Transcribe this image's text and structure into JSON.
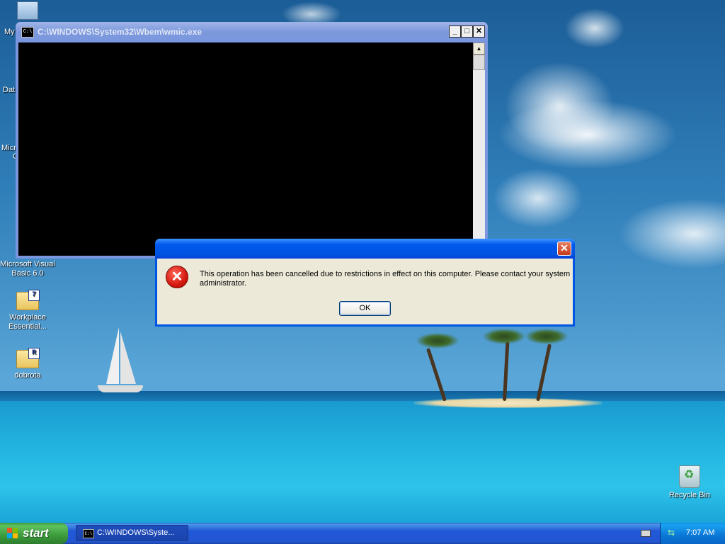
{
  "desktop": {
    "icons": [
      {
        "label": "My",
        "badge": ""
      },
      {
        "label": "Dat",
        "badge": ""
      },
      {
        "label": "Micro",
        "badge": ""
      },
      {
        "label": "C",
        "badge": ""
      },
      {
        "label": "Microsoft Visual Basic 6.0",
        "badge": ""
      },
      {
        "label": "Workplace Essential...",
        "badge": "7"
      },
      {
        "label": "dobrota",
        "badge": "R"
      },
      {
        "label": "Recycle Bin",
        "badge": ""
      }
    ]
  },
  "console_window": {
    "title": "C:\\WINDOWS\\System32\\Wbem\\wmic.exe",
    "icon_text": "C:\\",
    "buttons": {
      "minimize": "_",
      "maximize": "□",
      "close": "✕"
    }
  },
  "error_dialog": {
    "title": "",
    "message": "This operation has been cancelled due to restrictions in effect on this computer. Please contact your system administrator.",
    "icon_glyph": "✕",
    "ok_label": "OK",
    "close_glyph": "✕"
  },
  "taskbar": {
    "start_label": "start",
    "tasks": [
      {
        "label": "C:\\WINDOWS\\Syste...",
        "icon_text": "C:\\"
      }
    ],
    "clock": "7:07 AM"
  },
  "colors": {
    "title_active": "#0055e5",
    "title_inactive": "#7a96df",
    "dialog_face": "#ece9d8",
    "start_green": "#3c9b3c"
  }
}
